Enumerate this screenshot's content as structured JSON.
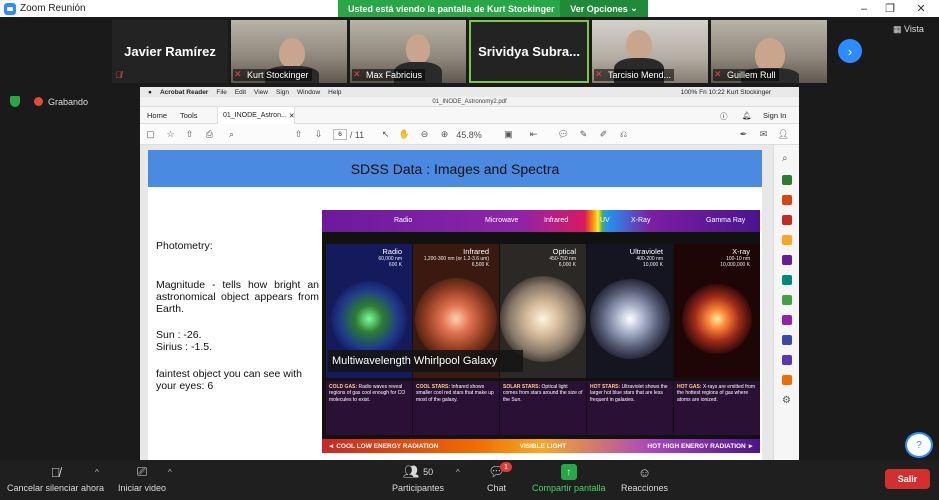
{
  "window": {
    "title": "Zoom Reunión",
    "share_banner": "Usted está viendo la pantalla de Kurt Stockinger",
    "share_options": "Ver Opciones",
    "vista_label": "Vista"
  },
  "gallery": {
    "tiles": [
      {
        "name": "Javier Ramírez",
        "type": "name-only"
      },
      {
        "name": "Kurt Stockinger",
        "type": "video"
      },
      {
        "name": "Max Fabricius",
        "type": "video"
      },
      {
        "name": "Srividya  Subra...",
        "type": "name-only"
      },
      {
        "name": "Tarcisio Mend...",
        "type": "video"
      },
      {
        "name": "Guillem Rull",
        "type": "video"
      }
    ]
  },
  "status": {
    "recording_label": "Grabando"
  },
  "acrobat": {
    "app_name": "Acrobat Reader",
    "menu": [
      "File",
      "Edit",
      "View",
      "Sign",
      "Window",
      "Help"
    ],
    "mac_status": "100%  Fri 10:22   Kurt Stockinger",
    "doc_filename": "01_INODE_Astronomy2.pdf",
    "tabs": {
      "home": "Home",
      "tools": "Tools",
      "doc_tab": "01_INODE_Astron...",
      "sign_in": "Sign In"
    },
    "page_current": "6",
    "page_total": "/ 11",
    "zoom": "45.8%"
  },
  "slide": {
    "title": "SDSS Data : Images and Spectra",
    "photometry": "Photometry:",
    "magnitude": "Magnitude - tells how bright an astronomical object appears from Earth.",
    "sun": "Sun : -26.",
    "sirius": "Sirius :  -1.5.",
    "faintest": "faintest object you can see with your eyes:  6"
  },
  "infographic": {
    "spectrum_labels": [
      "Radio",
      "Microwave",
      "Infrared",
      "UV",
      "X-Ray",
      "Gamma Ray"
    ],
    "panels": [
      {
        "title": "Radio",
        "sub": "60,000 nm\n600 K",
        "color": "#1a237e"
      },
      {
        "title": "Infrared",
        "sub": "1,200-300 nm (or 1.2-3.6 um)\n6,500 K",
        "color": "#5d2a1a"
      },
      {
        "title": "Optical",
        "sub": "450-750 nm\n6,000 K",
        "color": "#3e3a36"
      },
      {
        "title": "Ultraviolet",
        "sub": "400-200 nm\n10,000 K",
        "color": "#1c1c2a"
      },
      {
        "title": "X-ray",
        "sub": "100-10 nm\n10,000,000 K",
        "color": "#2a0a0a"
      }
    ],
    "banner": "Multiwavelength Whirlpool Galaxy",
    "descriptions": [
      {
        "head": "COLD GAS:",
        "text": "Radio waves reveal regions of gas cool enough for CO molecules to exist."
      },
      {
        "head": "COOL STARS:",
        "text": "Infrared shows smaller cool red stars that make up most of the galaxy."
      },
      {
        "head": "SOLAR STARS:",
        "text": "Optical light comes from stars around the size of the Sun."
      },
      {
        "head": "HOT STARS:",
        "text": "Ultraviolet shows the larger hot blue stars that are less frequent in galaxies."
      },
      {
        "head": "HOT GAS:",
        "text": "X-rays are emitted from the hottest regions of gas where atoms are ionized."
      }
    ],
    "energy_left": "◄ COOL LOW ENERGY RADIATION",
    "energy_mid": "VISIBLE LIGHT",
    "energy_right": "HOT HIGH ENERGY RADIATION ►"
  },
  "bottom": {
    "mute": "Cancelar silenciar ahora",
    "video": "Iniciar video",
    "participants": "Participantes",
    "participants_count": "50",
    "chat": "Chat",
    "chat_badge": "1",
    "share": "Compartir pantalla",
    "reactions": "Reacciones",
    "leave": "Salir"
  }
}
